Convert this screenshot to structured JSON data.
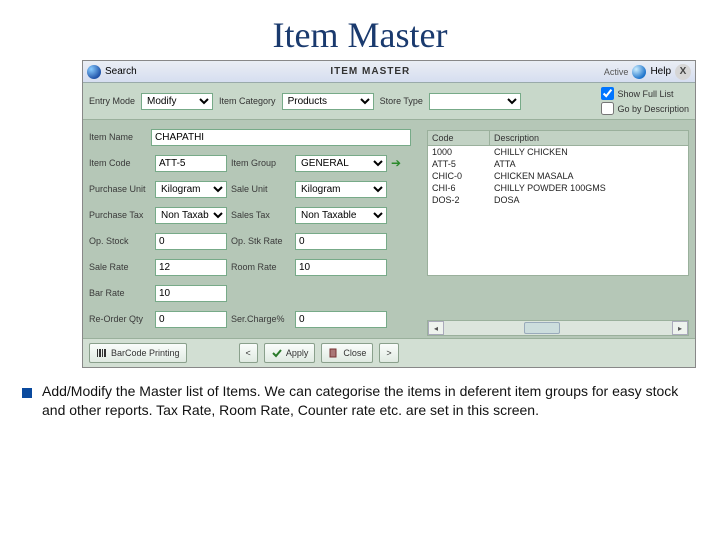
{
  "slide_title": "Item Master",
  "titlebar": {
    "search": "Search",
    "title": "ITEM  MASTER",
    "active": "Active",
    "help": "Help",
    "close": "X"
  },
  "toprow": {
    "entry_mode_label": "Entry Mode",
    "entry_mode_value": "Modify",
    "item_category_label": "Item Category",
    "item_category_value": "Products",
    "store_type_label": "Store Type",
    "store_type_value": ""
  },
  "checks": {
    "show_full_list": "Show Full List",
    "by_description": "Go by Description"
  },
  "form": {
    "item_name_label": "Item Name",
    "item_name_value": "CHAPATHI",
    "item_code_label": "Item Code",
    "item_code_value": "ATT-5",
    "item_group_label": "Item Group",
    "item_group_value": "GENERAL",
    "purchase_unit_label": "Purchase Unit",
    "purchase_unit_value": "Kilogram",
    "sale_unit_label": "Sale Unit",
    "sale_unit_value": "Kilogram",
    "purchase_tax_label": "Purchase Tax",
    "purchase_tax_value": "Non Taxable",
    "sales_tax_label": "Sales Tax",
    "sales_tax_value": "Non Taxable",
    "op_stock_label": "Op. Stock",
    "op_stock_value": "0",
    "op_stk_rate_label": "Op. Stk Rate",
    "op_stk_rate_value": "0",
    "sale_rate_label": "Sale Rate",
    "sale_rate_value": "12",
    "room_rate_label": "Room Rate",
    "room_rate_value": "10",
    "bar_rate_label": "Bar Rate",
    "bar_rate_value": "10",
    "reorder_qty_label": "Re-Order Qty",
    "reorder_qty_value": "0",
    "ser_charge_label": "Ser.Charge%",
    "ser_charge_value": "0"
  },
  "grid": {
    "col_code": "Code",
    "col_desc": "Description",
    "rows": [
      {
        "code": "1000",
        "desc": "CHILLY CHICKEN"
      },
      {
        "code": "ATT-5",
        "desc": "ATTA"
      },
      {
        "code": "CHIC-0",
        "desc": "CHICKEN MASALA"
      },
      {
        "code": "CHI-6",
        "desc": "CHILLY POWDER 100GMS"
      },
      {
        "code": "DOS-2",
        "desc": "DOSA"
      }
    ]
  },
  "buttons": {
    "barcode": "BarCode Printing",
    "prev": "<",
    "apply": "Apply",
    "close": "Close",
    "next": ">"
  },
  "caption": "Add/Modify the Master list of Items. We can categorise the items in deferent item groups for easy stock and other reports. Tax Rate, Room Rate, Counter rate etc. are set in this screen."
}
